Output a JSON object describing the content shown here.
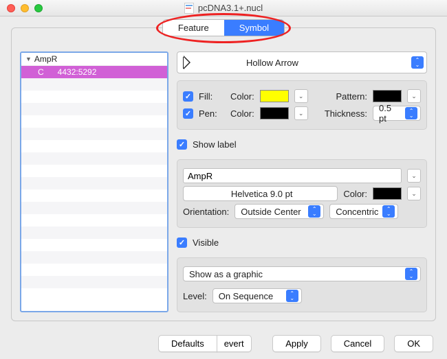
{
  "window": {
    "title": "pcDNA3.1+.nucl"
  },
  "tabs": {
    "feature": "Feature",
    "symbol": "Symbol",
    "active": "symbol"
  },
  "list": {
    "header": "AmpR",
    "selected": {
      "strand": "C",
      "range": "4432:5292"
    }
  },
  "shape": {
    "label": "Hollow Arrow"
  },
  "fill": {
    "check": "Fill:",
    "color_lbl": "Color:",
    "color": "#ffff00",
    "pattern_lbl": "Pattern:",
    "pattern": "#000000"
  },
  "pen": {
    "check": "Pen:",
    "color_lbl": "Color:",
    "color": "#000000",
    "thick_lbl": "Thickness:",
    "thick": "0.5 pt"
  },
  "label": {
    "show": "Show label",
    "name": "AmpR",
    "font": "Helvetica 9.0 pt",
    "color_lbl": "Color:",
    "color": "#000000",
    "orient_lbl": "Orientation:",
    "orient": "Outside Center",
    "layout": "Concentric"
  },
  "vis": {
    "visible": "Visible",
    "mode": "Show as a graphic",
    "level_lbl": "Level:",
    "level": "On Sequence"
  },
  "buttons": {
    "defaults": "Defaults",
    "revert": "evert",
    "apply": "Apply",
    "cancel": "Cancel",
    "ok": "OK"
  }
}
